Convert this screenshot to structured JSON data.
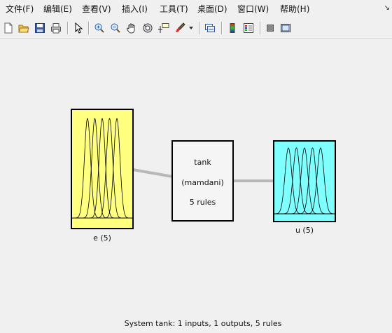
{
  "menu": [
    {
      "label": "文件(F)"
    },
    {
      "label": "编辑(E)"
    },
    {
      "label": "查看(V)"
    },
    {
      "label": "插入(I)"
    },
    {
      "label": "工具(T)"
    },
    {
      "label": "桌面(D)"
    },
    {
      "label": "窗口(W)"
    },
    {
      "label": "帮助(H)"
    }
  ],
  "toolbar": [
    "new-file",
    "open-folder",
    "save",
    "print",
    "pointer",
    "zoom-in",
    "zoom-out",
    "pan",
    "rotate-3d",
    "data-cursor",
    "brush",
    "link",
    "colorbar",
    "legend",
    "hide-plot-tools",
    "show-plot-tools"
  ],
  "diagram": {
    "input": {
      "label": "e (5)",
      "color": "#ffff80",
      "mf_count": 5
    },
    "system": {
      "name": "tank",
      "type": "(mamdani)",
      "rules": "5 rules"
    },
    "output": {
      "label": "u (5)",
      "color": "#80ffff",
      "mf_count": 5
    }
  },
  "status": "System tank: 1 inputs, 1 outputs, 5 rules"
}
